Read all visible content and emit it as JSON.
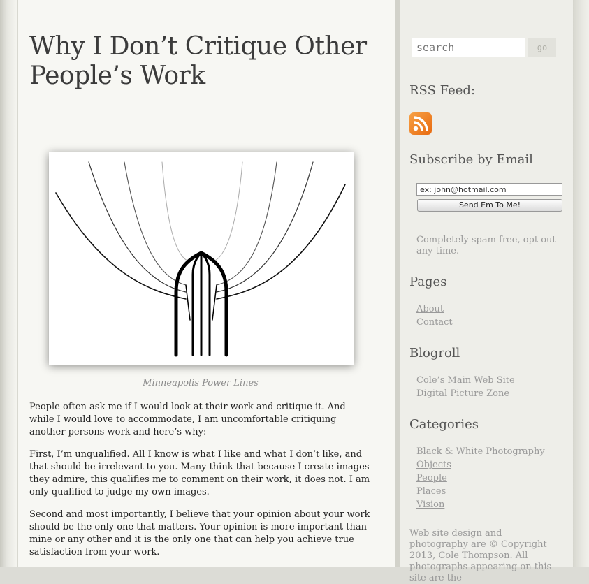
{
  "post": {
    "title": "Why I Don’t Critique Other People’s Work",
    "caption": "Minneapolis Power Lines",
    "paragraphs": [
      "People often ask me if I would look at their work and critique it. And while I would love to accommodate, I am uncomfortable critiquing another persons work and here’s why:",
      "First, I’m unqualified.  All I know is what I like and what I don’t like, and that should be irrelevant to you. Many think that because I create images they admire, this qualifies me to comment on their work, it does not.  I am only qualified to judge my own images.",
      "Second and most importantly, I believe that your opinion about your work should be the only one that matters. Your opinion is more important than mine or any other and it is the only one that can help you achieve true satisfaction from your work."
    ]
  },
  "sidebar": {
    "search": {
      "placeholder": "search",
      "go_label": "go"
    },
    "rss_heading": "RSS Feed:",
    "rss_icon": "rss-feed-icon",
    "subscribe_heading": "Subscribe by Email",
    "email_value": "ex: john@hotmail.com",
    "email_button": "Send Em To Me!",
    "spam_note": "Completely spam free, opt out any time.",
    "pages_heading": "Pages",
    "pages": [
      "About",
      "Contact"
    ],
    "blogroll_heading": "Blogroll",
    "blogroll": [
      "Cole’s Main Web Site",
      "Digital Picture Zone"
    ],
    "categories_heading": "Categories",
    "categories": [
      "Black & White Photography",
      "Objects",
      "People",
      "Places",
      "Vision"
    ],
    "footer_note": "Web site design and photography are © Copyright 2013, Cole Thompson. All photographs appearing on this site are the"
  },
  "colors": {
    "rss_orange": "#f08a2a",
    "link_gray": "#999999",
    "title_gray": "#3b3b3b"
  }
}
